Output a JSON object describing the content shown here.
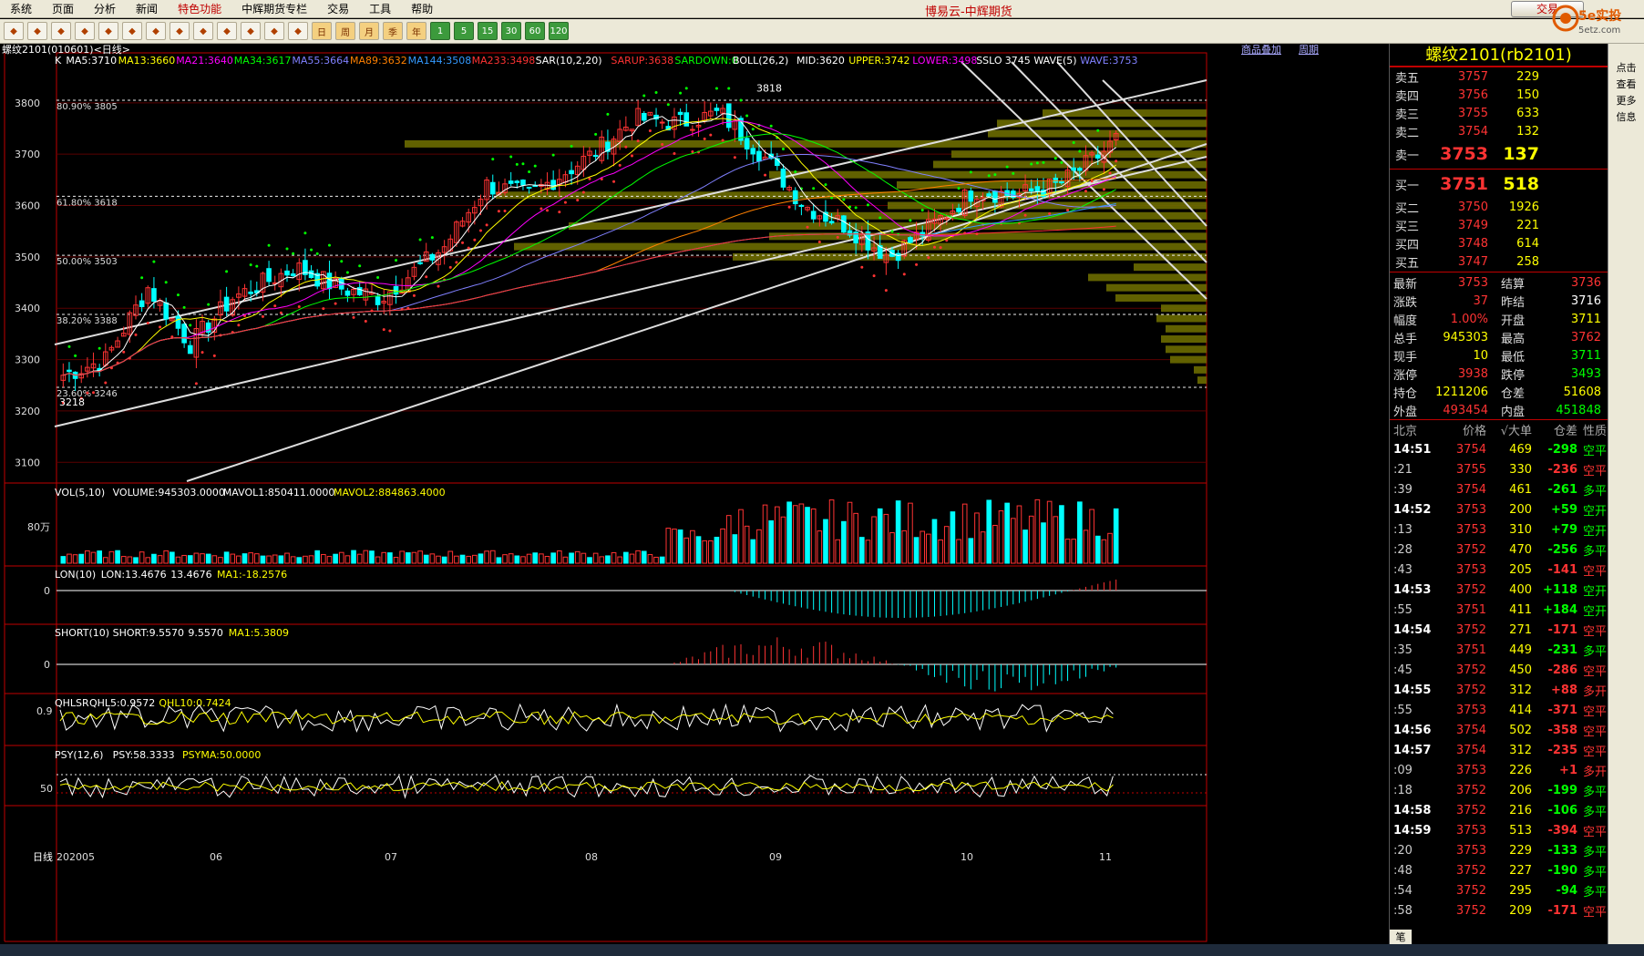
{
  "menu": [
    "系统",
    "页面",
    "分析",
    "新闻",
    "特色功能",
    "中辉期货专栏",
    "交易",
    "工具",
    "帮助"
  ],
  "app_title": "博易云-中辉期货",
  "trade_button": "交易",
  "logo_text": "5e实投",
  "logo_sub": "5etz.com",
  "toolbar_periods": [
    "日",
    "周",
    "月",
    "季",
    "年"
  ],
  "toolbar_minutes": [
    "1",
    "5",
    "15",
    "30",
    "60",
    "120"
  ],
  "chart_header": "螺纹2101(010601)<日线>",
  "top_links": [
    "商品叠加",
    "周期"
  ],
  "ma_legend": [
    {
      "t": "K",
      "c": "#ffffff"
    },
    {
      "t": "MA5:3710",
      "c": "#ffffff"
    },
    {
      "t": "MA13:3660",
      "c": "#ffff00"
    },
    {
      "t": "MA21:3640",
      "c": "#ff00ff"
    },
    {
      "t": "MA34:3617",
      "c": "#00ff00"
    },
    {
      "t": "MA55:3664",
      "c": "#8080ff"
    },
    {
      "t": "MA89:3632",
      "c": "#ff8000"
    },
    {
      "t": "MA144:3508",
      "c": "#3399ff"
    },
    {
      "t": "MA233:3498",
      "c": "#ff3333"
    },
    {
      "t": "SAR(10,2,20)",
      "c": "#ffffff"
    },
    {
      "t": "SARUP:3638",
      "c": "#ff3333"
    },
    {
      "t": "SARDOWN:0",
      "c": "#00ff00"
    },
    {
      "t": "BOLL(26,2)",
      "c": "#ffffff"
    },
    {
      "t": "MID:3620",
      "c": "#ffffff"
    },
    {
      "t": "UPPER:3742",
      "c": "#ffff00"
    },
    {
      "t": "LOWER:3498",
      "c": "#ff00ff"
    },
    {
      "t": "SSLO",
      "c": "#ffffff"
    },
    {
      "t": "3745",
      "c": "#ffffff"
    },
    {
      "t": "WAVE(5)",
      "c": "#ffffff"
    },
    {
      "t": "WAVE:3753",
      "c": "#8080ff"
    }
  ],
  "price_axis": [
    "3800",
    "3700",
    "3600",
    "3500",
    "3400",
    "3300",
    "3200",
    "3100"
  ],
  "fib": [
    "80.90% 3805",
    "61.80% 3618",
    "50.00% 3503",
    "38.20% 3388",
    "23.60% 3246"
  ],
  "high_label": "3818",
  "low_label": "3218",
  "vol_legend": [
    {
      "t": "VOL(5,10)",
      "c": "#ffffff"
    },
    {
      "t": "VOLUME:945303.0000",
      "c": "#ffffff"
    },
    {
      "t": "MAVOL1:850411.0000",
      "c": "#ffffff"
    },
    {
      "t": "MAVOL2:884863.4000",
      "c": "#ffff00"
    }
  ],
  "vol_axis": "80万",
  "lon_legend": [
    {
      "t": "LON(10)",
      "c": "#ffffff"
    },
    {
      "t": "LON:13.4676",
      "c": "#ffffff"
    },
    {
      "t": "13.4676",
      "c": "#ffffff"
    },
    {
      "t": "MA1:-18.2576",
      "c": "#ffff00"
    }
  ],
  "lon_axis": "0",
  "short_legend": [
    {
      "t": "SHORT(10)",
      "c": "#ffffff"
    },
    {
      "t": "SHORT:9.5570",
      "c": "#ffffff"
    },
    {
      "t": "9.5570",
      "c": "#ffffff"
    },
    {
      "t": "MA1:5.3809",
      "c": "#ffff00"
    }
  ],
  "short_axis": "0",
  "qhl_legend": [
    {
      "t": "QHLSR",
      "c": "#ffffff"
    },
    {
      "t": "QHL5:0.9572",
      "c": "#ffffff"
    },
    {
      "t": "QHL10:0.7424",
      "c": "#ffff00"
    }
  ],
  "qhl_axis": "0.9",
  "psy_legend": [
    {
      "t": "PSY(12,6)",
      "c": "#ffffff"
    },
    {
      "t": "PSY:58.3333",
      "c": "#ffffff"
    },
    {
      "t": "PSYMA:50.0000",
      "c": "#ffff00"
    }
  ],
  "psy_axis": "50",
  "date_axis": [
    "日线",
    "202005",
    "06",
    "07",
    "08",
    "09",
    "10",
    "11"
  ],
  "panel": {
    "title": "螺纹2101(rb2101)",
    "asks": [
      [
        "卖五",
        "3757",
        "229"
      ],
      [
        "卖四",
        "3756",
        "150"
      ],
      [
        "卖三",
        "3755",
        "633"
      ],
      [
        "卖二",
        "3754",
        "132"
      ]
    ],
    "ask1": [
      "卖一",
      "3753",
      "137"
    ],
    "bid1": [
      "买一",
      "3751",
      "518"
    ],
    "bids": [
      [
        "买二",
        "3750",
        "1926"
      ],
      [
        "买三",
        "3749",
        "221"
      ],
      [
        "买四",
        "3748",
        "614"
      ],
      [
        "买五",
        "3747",
        "258"
      ]
    ],
    "stats": [
      [
        "最新",
        "3753",
        "#ff3333",
        "结算",
        "3736",
        "#ff3333"
      ],
      [
        "涨跌",
        "37",
        "#ff3333",
        "昨结",
        "3716",
        "#ffffff"
      ],
      [
        "幅度",
        "1.00%",
        "#ff3333",
        "开盘",
        "3711",
        "#ffff00"
      ],
      [
        "总手",
        "945303",
        "#ffff00",
        "最高",
        "3762",
        "#ff3333"
      ],
      [
        "现手",
        "10",
        "#ffff00",
        "最低",
        "3711",
        "#00ff00"
      ],
      [
        "涨停",
        "3938",
        "#ff3333",
        "跌停",
        "3493",
        "#00ff00"
      ],
      [
        "持仓",
        "1211206",
        "#ffff00",
        "仓差",
        "51608",
        "#ffff00"
      ],
      [
        "外盘",
        "493454",
        "#ff3333",
        "内盘",
        "451848",
        "#00ff00"
      ]
    ],
    "tick_header": [
      "北京",
      "价格",
      "√大单",
      "仓差",
      "性质"
    ],
    "ticks": [
      [
        "14:51",
        "3754",
        "469",
        "-298",
        "空平",
        "g",
        true
      ],
      [
        ":21",
        "3755",
        "330",
        "-236",
        "空平",
        "r",
        false
      ],
      [
        ":39",
        "3754",
        "461",
        "-261",
        "多平",
        "g",
        false
      ],
      [
        "14:52",
        "3753",
        "200",
        "+59",
        "空开",
        "g",
        true
      ],
      [
        ":13",
        "3753",
        "310",
        "+79",
        "空开",
        "g",
        false
      ],
      [
        ":28",
        "3752",
        "470",
        "-256",
        "多平",
        "g",
        false
      ],
      [
        ":43",
        "3753",
        "205",
        "-141",
        "空平",
        "r",
        false
      ],
      [
        "14:53",
        "3752",
        "400",
        "+118",
        "空开",
        "g",
        true
      ],
      [
        ":55",
        "3751",
        "411",
        "+184",
        "空开",
        "g",
        false
      ],
      [
        "14:54",
        "3752",
        "271",
        "-171",
        "空平",
        "r",
        true
      ],
      [
        ":35",
        "3751",
        "449",
        "-231",
        "多平",
        "g",
        false
      ],
      [
        ":45",
        "3752",
        "450",
        "-286",
        "空平",
        "r",
        false
      ],
      [
        "14:55",
        "3752",
        "312",
        "+88",
        "多开",
        "r",
        true
      ],
      [
        ":55",
        "3753",
        "414",
        "-371",
        "空平",
        "r",
        false
      ],
      [
        "14:56",
        "3754",
        "502",
        "-358",
        "空平",
        "r",
        true
      ],
      [
        "14:57",
        "3754",
        "312",
        "-235",
        "空平",
        "r",
        true
      ],
      [
        ":09",
        "3753",
        "226",
        "+1",
        "多开",
        "r",
        false
      ],
      [
        ":18",
        "3752",
        "206",
        "-199",
        "多平",
        "g",
        false
      ],
      [
        "14:58",
        "3752",
        "216",
        "-106",
        "多平",
        "g",
        true
      ],
      [
        "14:59",
        "3753",
        "513",
        "-394",
        "空平",
        "r",
        true
      ],
      [
        ":20",
        "3753",
        "229",
        "-133",
        "多平",
        "g",
        false
      ],
      [
        ":48",
        "3752",
        "227",
        "-190",
        "多平",
        "g",
        false
      ],
      [
        ":54",
        "3752",
        "295",
        "-94",
        "多平",
        "g",
        false
      ],
      [
        ":58",
        "3752",
        "209",
        "-171",
        "空平",
        "r",
        false
      ]
    ],
    "bottom_tab": "笔"
  },
  "edge_text": [
    "点击",
    "查看",
    "更多",
    "信息"
  ]
}
